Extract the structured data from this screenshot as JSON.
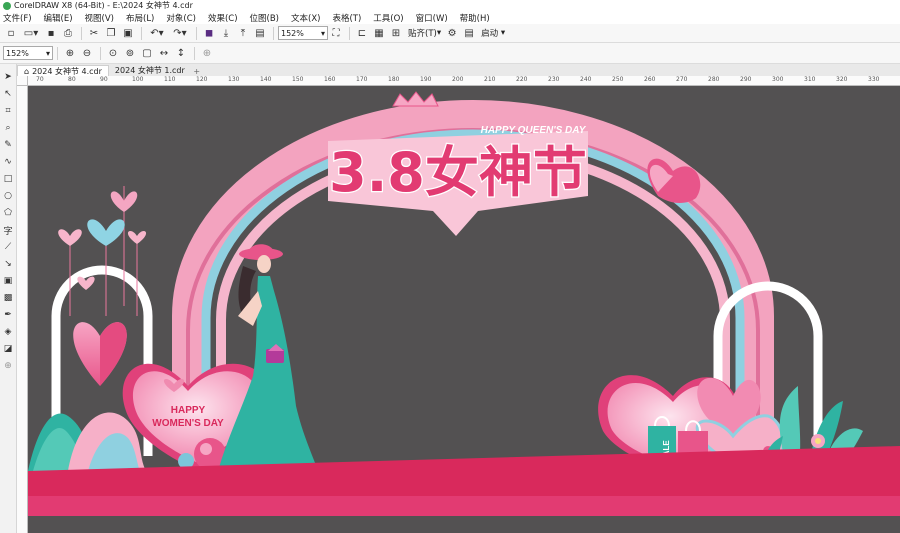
{
  "window": {
    "title": "CorelDRAW X8 (64-Bit) - E:\\2024 女神节 4.cdr"
  },
  "menu": [
    "文件(F)",
    "编辑(E)",
    "视图(V)",
    "布局(L)",
    "对象(C)",
    "效果(C)",
    "位图(B)",
    "文本(X)",
    "表格(T)",
    "工具(O)",
    "窗口(W)",
    "帮助(H)"
  ],
  "toolbar": {
    "zoom_value": "152%",
    "snap_label": "贴齐(T)",
    "launch_label": "启动"
  },
  "propbar": {
    "zoom_value": "152%"
  },
  "tabs": [
    {
      "label": "2024 女神节 4.cdr",
      "active": true
    },
    {
      "label": "2024 女神节 1.cdr",
      "active": false
    }
  ],
  "ruler": {
    "ticks": [
      "70",
      "80",
      "90",
      "100",
      "110",
      "120",
      "130",
      "140",
      "150",
      "160",
      "170",
      "180",
      "190",
      "200",
      "210",
      "220",
      "230",
      "240",
      "250",
      "260",
      "270",
      "280",
      "290",
      "300",
      "310",
      "320",
      "330"
    ]
  },
  "artwork": {
    "headline": "3.8女神节",
    "headline_sub": "HAPPY QUEEN'S DAY",
    "heart_sign_line1": "HAPPY",
    "heart_sign_line2": "WOMEN'S DAY",
    "bag_label": "SALE"
  },
  "colors": {
    "canvas_bg": "#535152",
    "pink": "#f08bb0",
    "hot_pink": "#e23b72",
    "light_blue": "#8fd0e0",
    "teal": "#2fb3a2",
    "stage": "#d9295c"
  }
}
